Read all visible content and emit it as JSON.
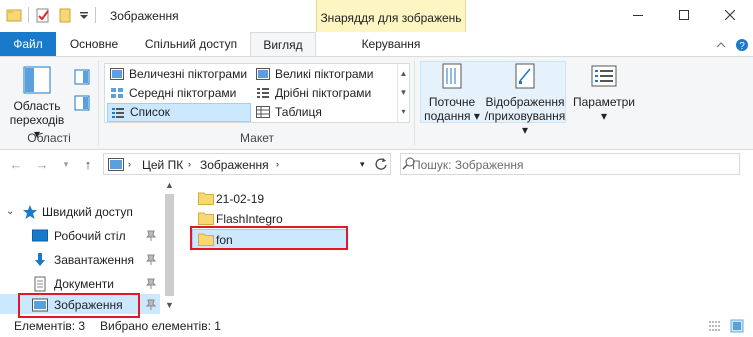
{
  "window": {
    "title": "Зображення",
    "context_tab_group": "Знаряддя для зображень"
  },
  "tabs": {
    "file": "Файл",
    "home": "Основне",
    "share": "Спільний доступ",
    "view": "Вигляд",
    "manage": "Керування"
  },
  "ribbon": {
    "panes": {
      "nav_pane_label_line1": "Область",
      "nav_pane_label_line2": "переходів",
      "group_label": "Області"
    },
    "layout": {
      "group_label": "Макет",
      "items": [
        "Величезні піктограми",
        "Великі піктограми",
        "Середні піктограми",
        "Дрібні піктограми",
        "Список",
        "Таблиця"
      ],
      "selected": "Список"
    },
    "current_view": {
      "line1": "Поточне",
      "line2": "подання"
    },
    "show_hide": {
      "line1": "Відображення",
      "line2": "/приховування"
    },
    "options": {
      "label": "Параметри"
    }
  },
  "address": {
    "crumbs": [
      "Цей ПК",
      "Зображення"
    ],
    "search_placeholder": "Пошук: Зображення"
  },
  "nav_pane": {
    "quick_access": "Швидкий доступ",
    "items": [
      {
        "label": "Робочий стіл",
        "icon": "desktop-icon"
      },
      {
        "label": "Завантаження",
        "icon": "download-icon"
      },
      {
        "label": "Документи",
        "icon": "documents-icon"
      },
      {
        "label": "Зображення",
        "icon": "pictures-icon"
      }
    ],
    "selected": "Зображення"
  },
  "files": [
    {
      "name": "21-02-19",
      "type": "folder"
    },
    {
      "name": "FlashIntegro",
      "type": "folder"
    },
    {
      "name": "fon",
      "type": "folder",
      "selected": true
    }
  ],
  "status": {
    "items_count": "Елементів: 3",
    "selected_count": "Вибрано елементів: 1"
  },
  "colors": {
    "accent": "#1979ca",
    "selection": "#cce8ff",
    "context_tab": "#fef6c2",
    "annotation_red": "#e2172a",
    "folder": "#f8d775"
  }
}
